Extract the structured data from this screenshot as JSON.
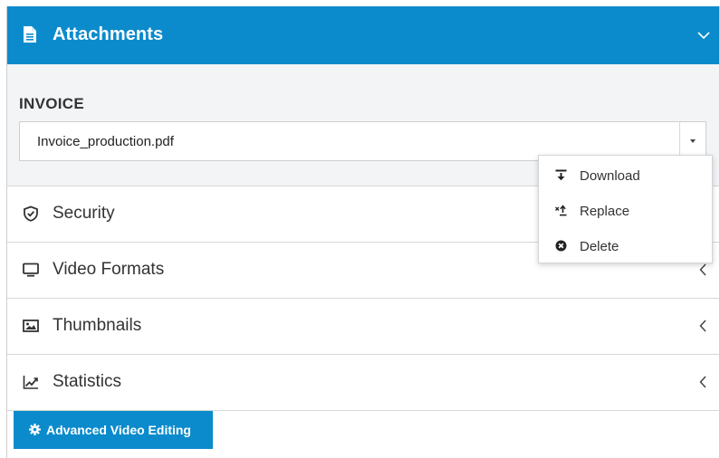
{
  "header": {
    "title": "Attachments"
  },
  "invoice": {
    "label": "INVOICE",
    "selected_file": "Invoice_production.pdf"
  },
  "dropdown_menu": {
    "items": [
      {
        "label": "Download",
        "icon": "download-icon"
      },
      {
        "label": "Replace",
        "icon": "replace-icon"
      },
      {
        "label": "Delete",
        "icon": "delete-icon"
      }
    ]
  },
  "sections": [
    {
      "label": "Security",
      "icon": "shield-icon"
    },
    {
      "label": "Video Formats",
      "icon": "monitor-icon"
    },
    {
      "label": "Thumbnails",
      "icon": "image-icon"
    },
    {
      "label": "Statistics",
      "icon": "line-chart-icon"
    }
  ],
  "advanced_button": {
    "label": "Advanced Video Editing",
    "icon": "gear-icon"
  },
  "colors": {
    "accent": "#0b8bcc",
    "panel_bg": "#f2f4f6",
    "border": "#d7d7d7"
  }
}
